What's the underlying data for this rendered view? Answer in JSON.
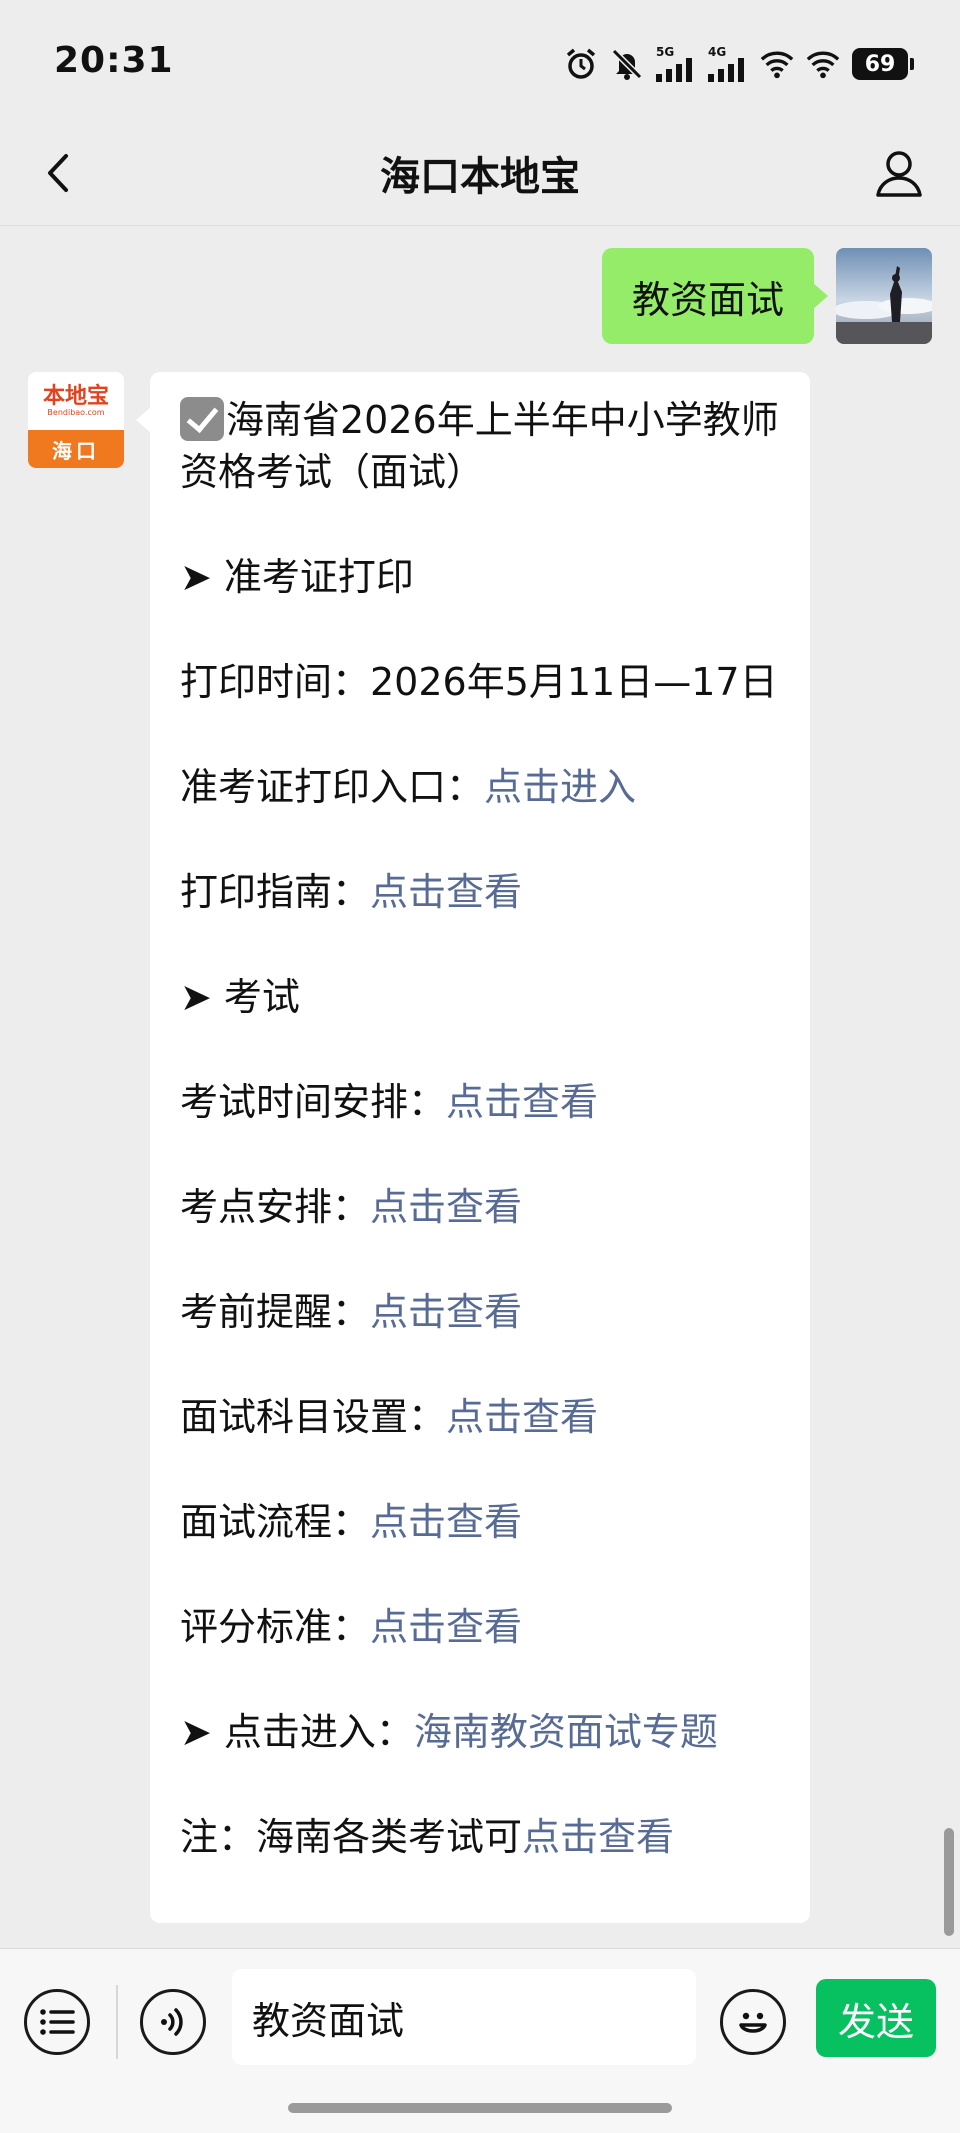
{
  "status_bar": {
    "time": "20:31",
    "signal1_label": "5G",
    "signal2_label": "4G",
    "battery": "69",
    "icons": [
      "alarm-icon",
      "mute-bell-icon",
      "signal-5g-icon",
      "signal-4g-icon",
      "wifi-icon",
      "wifi-icon",
      "battery-icon"
    ]
  },
  "nav": {
    "title": "海口本地宝",
    "back_icon": "chevron-left-icon",
    "profile_icon": "person-icon"
  },
  "chat": {
    "outgoing": {
      "text": "教资面试"
    },
    "incoming": {
      "avatar": {
        "brand": "本地宝",
        "domain": "Bendibao.com",
        "city": "海口"
      },
      "title": "海南省2026年上半年中小学教师资格考试（面试）",
      "section1": "➤ 准考证打印",
      "print_time": "打印时间：2026年5月11日—17日",
      "entry_label": "准考证打印入口：",
      "entry_link": "点击进入",
      "guide_label": "打印指南：",
      "guide_link": "点击查看",
      "section2": "➤ 考试",
      "schedule_label": "考试时间安排：",
      "schedule_link": "点击查看",
      "venue_label": "考点安排：",
      "venue_link": "点击查看",
      "reminder_label": "考前提醒：",
      "reminder_link": "点击查看",
      "subjects_label": "面试科目设置：",
      "subjects_link": "点击查看",
      "process_label": "面试流程：",
      "process_link": "点击查看",
      "scoring_label": "评分标准：",
      "scoring_link": "点击查看",
      "special_label": "➤ 点击进入：",
      "special_link": "海南教资面试专题",
      "note_label": "注：海南各类考试可",
      "note_link": "点击查看"
    }
  },
  "input_bar": {
    "menu_icon": "list-menu-icon",
    "voice_icon": "voice-icon",
    "input_value": "教资面试",
    "emoji_icon": "smiley-icon",
    "send_label": "发送"
  },
  "colors": {
    "background": "#ededed",
    "outgoing_bubble": "#95ec69",
    "link": "#576b95",
    "send_button": "#07c160",
    "brand_orange": "#f0781e"
  }
}
